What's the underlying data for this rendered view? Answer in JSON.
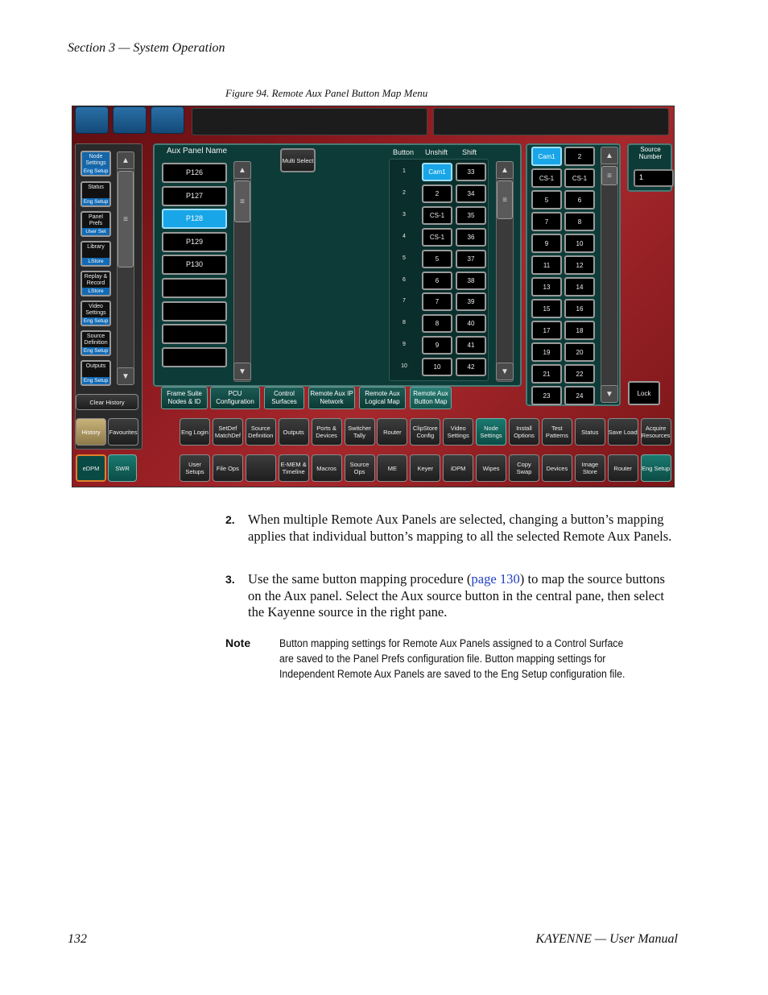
{
  "header": {
    "section": "Section 3 — System Operation"
  },
  "figure": {
    "caption": "Figure 94.  Remote Aux Panel Button Map Menu"
  },
  "ui": {
    "multi_select": "Multi Select",
    "aux_panel_name_label": "Aux Panel Name",
    "aux_panels": [
      "P126",
      "P127",
      "P128",
      "P129",
      "P130",
      "",
      "",
      "",
      ""
    ],
    "aux_selected_index": 2,
    "col_headers": {
      "button": "Button",
      "unshift": "Unshift",
      "shift": "Shift"
    },
    "button_rows": [
      {
        "num": "1",
        "unshift": "Cam1",
        "shift": "33"
      },
      {
        "num": "2",
        "unshift": "2",
        "shift": "34"
      },
      {
        "num": "3",
        "unshift": "CS-1",
        "shift": "35"
      },
      {
        "num": "4",
        "unshift": "CS-1",
        "shift": "36"
      },
      {
        "num": "5",
        "unshift": "5",
        "shift": "37"
      },
      {
        "num": "6",
        "unshift": "6",
        "shift": "38"
      },
      {
        "num": "7",
        "unshift": "7",
        "shift": "39"
      },
      {
        "num": "8",
        "unshift": "8",
        "shift": "40"
      },
      {
        "num": "9",
        "unshift": "9",
        "shift": "41"
      },
      {
        "num": "10",
        "unshift": "10",
        "shift": "42"
      }
    ],
    "source_grid": [
      "Cam1",
      "2",
      "CS-1",
      "CS-1",
      "5",
      "6",
      "7",
      "8",
      "9",
      "10",
      "11",
      "12",
      "13",
      "14",
      "15",
      "16",
      "17",
      "18",
      "19",
      "20",
      "21",
      "22",
      "23",
      "24"
    ],
    "source_number_label": "Source Number",
    "source_number_value": "1",
    "lock": "Lock",
    "sidebar": [
      {
        "label": "Node Settings",
        "sub": "Eng Setup"
      },
      {
        "label": "Status",
        "sub": "Eng Setup"
      },
      {
        "label": "Panel Prefs",
        "sub": "User Set"
      },
      {
        "label": "Library",
        "sub": "LStore"
      },
      {
        "label": "Replay & Record",
        "sub": "LStore"
      },
      {
        "label": "Video Settings",
        "sub": "Eng Setup"
      },
      {
        "label": "Source Definition",
        "sub": "Eng Setup"
      },
      {
        "label": "Outputs",
        "sub": "Eng Setup"
      }
    ],
    "clear_history": "Clear History",
    "history": "History",
    "favourites": "Favourites",
    "edpm": "eDPM",
    "swr": "SWR",
    "subtabs": [
      "Frame Suite Nodes & ID",
      "PCU Configuration",
      "Control Surfaces",
      "Remote Aux IP Network",
      "Remote Aux Logical Map",
      "Remote Aux Button Map"
    ],
    "row1": [
      "Eng Login",
      "SetDef MatchDef",
      "Source Definition",
      "Outputs",
      "Ports & Devices",
      "Switcher Tally",
      "Router",
      "ClipStore Config",
      "Video Settings",
      "Node Settings",
      "Install Options",
      "Test Patterns",
      "Status",
      "Save Load",
      "Acquire Resources"
    ],
    "row2": [
      "User Setups",
      "File Ops",
      "",
      "E-MEM & Timeline",
      "Macros",
      "Source Ops",
      "ME",
      "Keyer",
      "iDPM",
      "Wipes",
      "Copy Swap",
      "Devices",
      "Image Store",
      "Router",
      "Eng Setup"
    ]
  },
  "steps": [
    {
      "num": "2.",
      "text": "When multiple Remote Aux Panels are selected, changing a button’s mapping applies that individual button’s mapping to all the selected Remote Aux Panels."
    },
    {
      "num": "3.",
      "text_before": "Use the same button mapping procedure (",
      "link": "page 130",
      "text_after": ") to map the source buttons on the Aux panel. Select the Aux source button in the central pane, then select the Kayenne source in the right pane."
    }
  ],
  "note": {
    "label": "Note",
    "text": "Button mapping settings for Remote Aux Panels assigned to a Control Surface are saved to the Panel Prefs configuration file. Button mapping settings for Independent Remote Aux Panels are saved to the Eng Setup configuration file."
  },
  "footer": {
    "page": "132",
    "title": "KAYENNE  —  User Manual"
  }
}
